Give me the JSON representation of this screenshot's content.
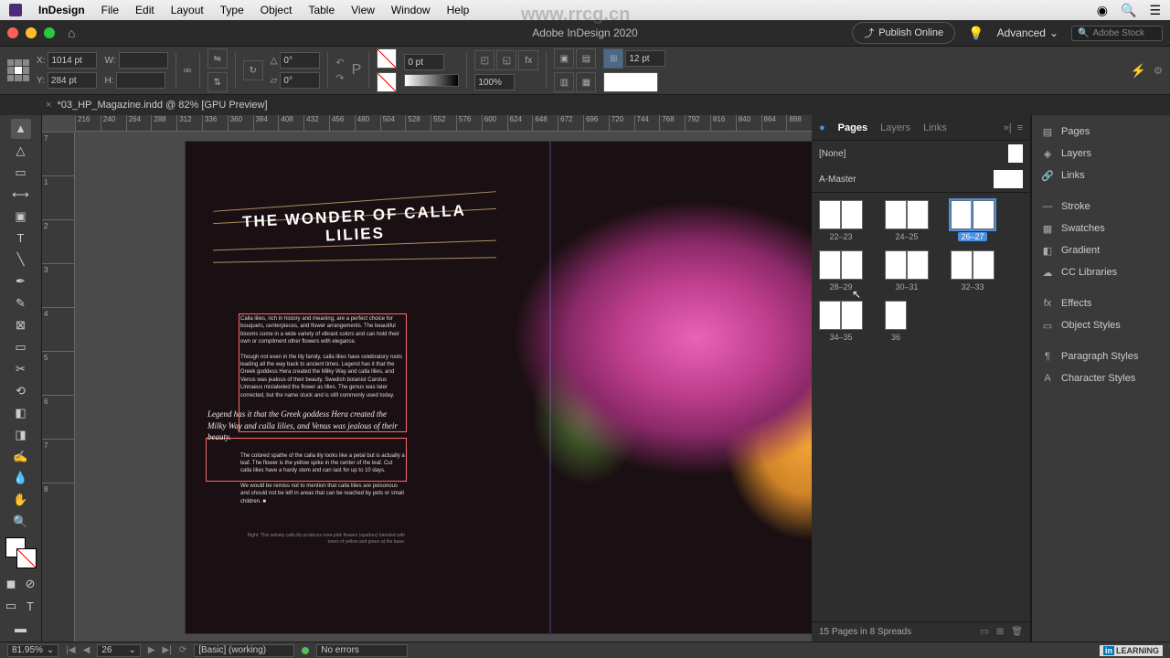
{
  "menubar": {
    "app": "InDesign",
    "items": [
      "File",
      "Edit",
      "Layout",
      "Type",
      "Object",
      "Table",
      "View",
      "Window",
      "Help"
    ]
  },
  "chrome": {
    "title": "Adobe InDesign 2020",
    "publish": "Publish Online",
    "workspace": "Advanced",
    "stock_placeholder": "Adobe Stock"
  },
  "control": {
    "x": "1014 pt",
    "y": "284 pt",
    "w": "",
    "h": "",
    "rotate": "0°",
    "shear": "0°",
    "stroke_weight": "0 pt",
    "opacity": "100%",
    "gap": "12 pt"
  },
  "doc_tab": "*03_HP_Magazine.indd @ 82% [GPU Preview]",
  "ruler_h": [
    "216",
    "240",
    "264",
    "288",
    "312",
    "336",
    "360",
    "384",
    "408",
    "432",
    "456",
    "480",
    "504",
    "528",
    "552",
    "576",
    "600",
    "624",
    "648",
    "672",
    "696",
    "720",
    "744",
    "768",
    "792",
    "816",
    "840",
    "864",
    "888"
  ],
  "ruler_v": [
    "7",
    "1",
    "2",
    "3",
    "4",
    "5",
    "6",
    "7",
    "8"
  ],
  "article": {
    "headline": "THE WONDER OF CALLA LILIES",
    "p1": "Calla lilies, rich in history and meaning, are a perfect choice for bouquets, centerpieces, and flower arrangements. The beautiful blooms come in a wide variety of vibrant colors and can hold their own or compliment other flowers with elegance.",
    "p2": "Though not even in the lily family, calla lilies have celebratory roots leading all the way back to ancient times. Legend has it that the Greek goddess Hera created the Milky Way and calla lilies, and Venus was jealous of their beauty. Swedish botanist Carolus Linnaeus mislabeled the flower as lilies. The genus was later corrected, but the name stuck and is still commonly used today.",
    "quote": "Legend has it that the Greek goddess Hera created the Milky Way and calla lilies, and Venus was jealous of their beauty.",
    "p3": "The colored spathe of the calla lily looks like a petal but is actually a leaf. The flower is the yellow spike in the center of the leaf. Cut calla lilies have a hardy stem and can last for up to 10 days.",
    "p4": "We would be remiss not to mention that calla lilies are poisonous and should not be left in areas that can be reached by pets or small children. ■",
    "caption": "Right: This velvety calla lily produces rose-pink flowers (spathes) blended with tones of yellow and green at the base."
  },
  "panels": {
    "tabs": [
      "Pages",
      "Layers",
      "Links"
    ],
    "masters": [
      {
        "name": "[None]",
        "pages": 1
      },
      {
        "name": "A-Master",
        "pages": 2
      }
    ],
    "spreads": [
      {
        "label": "22–23"
      },
      {
        "label": "24–25"
      },
      {
        "label": "26–27",
        "selected": true
      },
      {
        "label": "28–29"
      },
      {
        "label": "30–31"
      },
      {
        "label": "32–33"
      },
      {
        "label": "34–35"
      },
      {
        "label": "36",
        "single": true
      }
    ],
    "footer": "15 Pages in 8 Spreads"
  },
  "dock": [
    "Pages",
    "Layers",
    "Links",
    "",
    "Stroke",
    "Swatches",
    "Gradient",
    "CC Libraries",
    "",
    "Effects",
    "Object Styles",
    "",
    "Paragraph Styles",
    "Character Styles"
  ],
  "dock_icons": [
    "▤",
    "◈",
    "🔗",
    "",
    "—",
    "▦",
    "◧",
    "☁",
    "",
    "fx",
    "▭",
    "",
    "¶",
    "A"
  ],
  "status": {
    "zoom": "81.95%",
    "page": "26",
    "preset": "[Basic] (working)",
    "errors": "No errors"
  },
  "watermark_url": "www.rrcg.cn",
  "learning": "LEARNING"
}
